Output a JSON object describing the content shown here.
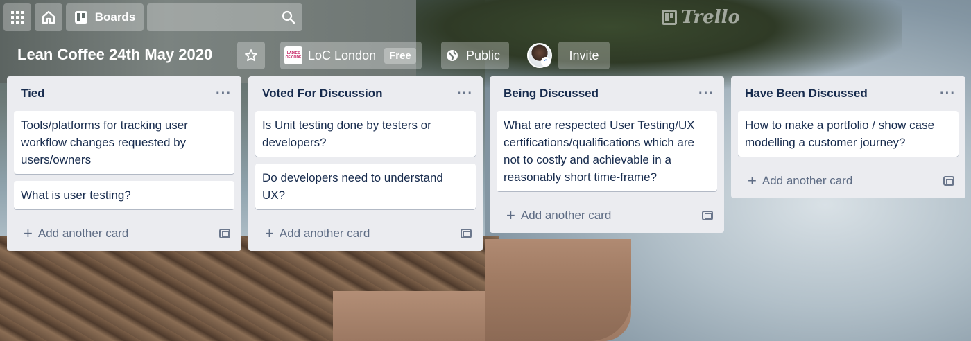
{
  "header": {
    "boards_label": "Boards",
    "logo_text": "Trello"
  },
  "board": {
    "title": "Lean Coffee 24th May 2020",
    "team_name": "LoC London",
    "team_logo_text": "LADIES OF CODE",
    "plan_badge": "Free",
    "visibility": "Public",
    "invite_label": "Invite"
  },
  "lists": [
    {
      "title": "Tied",
      "cards": [
        "Tools/platforms for tracking user workflow changes requested by users/owners",
        "What is user testing?"
      ],
      "add_label": "Add another card"
    },
    {
      "title": "Voted For Discussion",
      "cards": [
        "Is Unit testing done by testers or developers?",
        "Do developers need to understand UX?"
      ],
      "add_label": "Add another card"
    },
    {
      "title": "Being Discussed",
      "cards": [
        "What are respected User Testing/UX certifications/qualifications which are not to costly and achievable in a reasonably short time-frame?"
      ],
      "add_label": "Add another card"
    },
    {
      "title": "Have Been Discussed",
      "cards": [
        "How to make a portfolio / show case modelling a customer journey?"
      ],
      "add_label": "Add another card"
    }
  ],
  "icons": {
    "apps": "grid-icon",
    "home": "home-icon",
    "boards": "boards-icon",
    "search": "search-icon",
    "star": "star-icon",
    "public": "globe-icon",
    "list_menu": "more-icon",
    "add": "plus-icon",
    "template": "template-icon"
  },
  "colors": {
    "list_bg": "#ebecf0",
    "card_bg": "#ffffff",
    "text": "#172b4d",
    "muted": "#5e6c84"
  }
}
